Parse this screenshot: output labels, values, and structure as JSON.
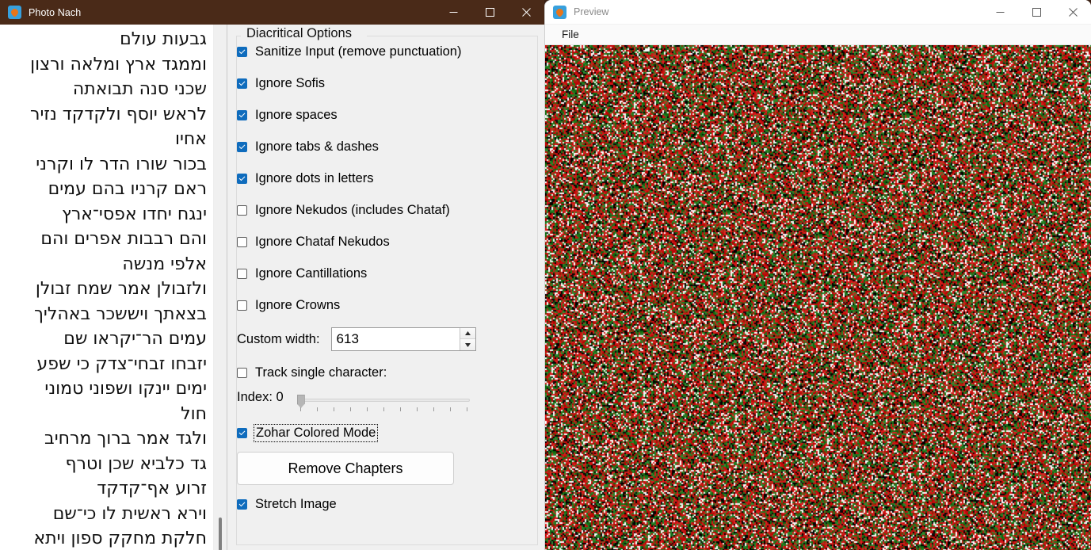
{
  "main_window": {
    "title": "Photo Nach",
    "icon": "photo-nach-app-icon",
    "controls": {
      "minimize": "–",
      "maximize": "□",
      "close": "✕"
    },
    "text_pane": {
      "content": "גבעות עולם\nוממגד ארץ ומלאה ורצון\nשכני סנה תבואתה\nלראש יוסף ולקדקד נזיר\nאחיו\nבכור שורו הדר לו וקרני\nראם קרניו בהם עמים\nינגח יחדו אפסי־ארץ\nוהם רבבות אפרים והם\nאלפי מנשה\nולזבולן אמר שמח זבולן\nבצאתך ויששכר באהליך\nעמים הר־יקראו שם\nיזבחו זבחי־צדק כי שפע\nימים יינקו ושפוני טמוני\nחול\nולגד אמר ברוך מרחיב\nגד כלביא שכן וטרף\nזרוע אף־קדקד\nוירא ראשית לו כי־שם\nחלקת מחקק ספון ויתא"
    },
    "options": {
      "group_title": "Diacritical Options",
      "checkboxes": [
        {
          "label": "Sanitize Input (remove punctuation)",
          "checked": true,
          "focused": false
        },
        {
          "label": "Ignore Sofis",
          "checked": true,
          "focused": false
        },
        {
          "label": "Ignore spaces",
          "checked": true,
          "focused": false
        },
        {
          "label": "Ignore tabs & dashes",
          "checked": true,
          "focused": false
        },
        {
          "label": "Ignore dots in letters",
          "checked": true,
          "focused": false
        },
        {
          "label": "Ignore Nekudos (includes Chataf)",
          "checked": false,
          "focused": false
        },
        {
          "label": "Ignore Chataf Nekudos",
          "checked": false,
          "focused": false
        },
        {
          "label": "Ignore Cantillations",
          "checked": false,
          "focused": false
        },
        {
          "label": "Ignore Crowns",
          "checked": false,
          "focused": false
        }
      ],
      "custom_width": {
        "label": "Custom width:",
        "value": "613",
        "spin_up": "▲",
        "spin_down": "▼"
      },
      "track_single_character": {
        "label": "Track single character:",
        "checked": false
      },
      "index_slider": {
        "label": "Index: 0",
        "value": 0,
        "min": 0,
        "max": 100,
        "tick_count": 11
      },
      "zohar_colored_mode": {
        "label": "Zohar Colored Mode",
        "checked": true,
        "focused": true
      },
      "remove_chapters_button": "Remove Chapters",
      "stretch_image": {
        "label": "Stretch Image",
        "checked": true,
        "focused": false
      }
    }
  },
  "preview_window": {
    "title": "Preview",
    "icon": "photo-nach-app-icon",
    "controls": {
      "minimize": "–",
      "maximize": "□",
      "close": "✕"
    },
    "menu": {
      "file": "File"
    },
    "image": {
      "description": "zohar-colored-noise-image",
      "palette": [
        "#cc1111",
        "#1f7a1f",
        "#ffffff",
        "#000000",
        "#8a3b12"
      ]
    }
  }
}
